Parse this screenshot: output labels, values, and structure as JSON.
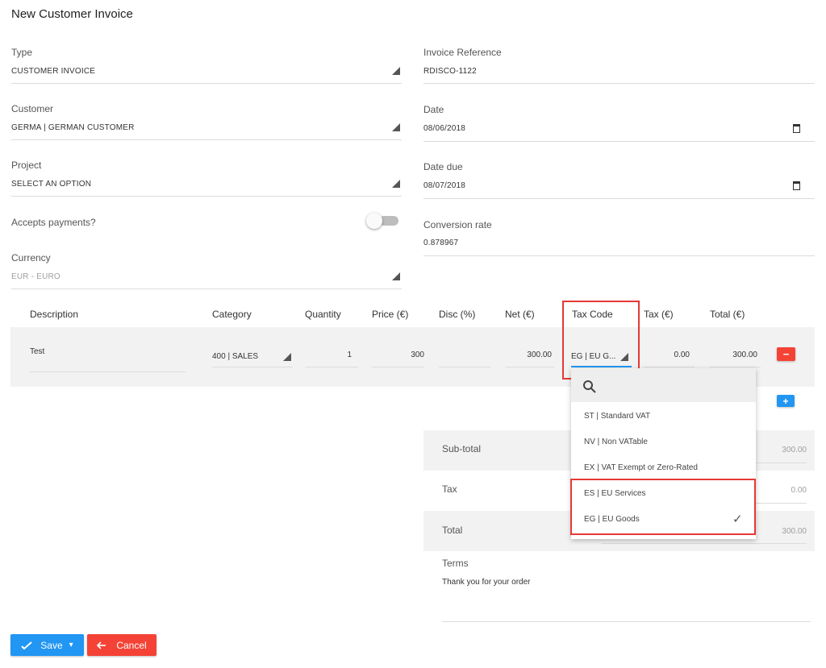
{
  "page": {
    "title": "New Customer Invoice"
  },
  "form": {
    "type": {
      "label": "Type",
      "value": "CUSTOMER INVOICE"
    },
    "invoice_reference": {
      "label": "Invoice Reference",
      "value": "RDISCO-1122"
    },
    "customer": {
      "label": "Customer",
      "value": "GERMA | GERMAN CUSTOMER"
    },
    "date": {
      "label": "Date",
      "value": "08/06/2018"
    },
    "project": {
      "label": "Project",
      "value": "SELECT AN OPTION"
    },
    "date_due": {
      "label": "Date due",
      "value": "08/07/2018"
    },
    "accepts_payments": {
      "label": "Accepts payments?",
      "checked": false
    },
    "conversion_rate": {
      "label": "Conversion rate",
      "value": "0.878967"
    },
    "currency": {
      "label": "Currency",
      "value": "EUR - EURO"
    }
  },
  "lines": {
    "headers": {
      "description": "Description",
      "category": "Category",
      "quantity": "Quantity",
      "price": "Price (€)",
      "disc": "Disc (%)",
      "net": "Net (€)",
      "tax_code": "Tax Code",
      "tax": "Tax (€)",
      "total": "Total (€)"
    },
    "rows": [
      {
        "description": "Test",
        "category": "400 | SALES",
        "quantity": "1",
        "price": "300",
        "disc": "",
        "net": "300.00",
        "tax_code": "EG | EU G...",
        "tax": "0.00",
        "total": "300.00"
      }
    ],
    "remove_label": "−",
    "add_label": "+"
  },
  "tax_dropdown": {
    "search_icon": "search-icon",
    "options": [
      {
        "label": "ST | Standard VAT",
        "selected": false
      },
      {
        "label": "NV | Non VATable",
        "selected": false
      },
      {
        "label": "EX | VAT Exempt or Zero-Rated",
        "selected": false
      },
      {
        "label": "ES | EU Services",
        "selected": false
      },
      {
        "label": "EG | EU Goods",
        "selected": true
      }
    ],
    "check_glyph": "✓"
  },
  "summary": {
    "subtotal": {
      "label": "Sub-total",
      "value": "300.00"
    },
    "tax": {
      "label": "Tax",
      "value": "0.00"
    },
    "total": {
      "label": "Total",
      "value": "300.00"
    },
    "terms": {
      "label": "Terms",
      "value": "Thank you for your order"
    }
  },
  "actions": {
    "save": {
      "label": "Save",
      "icon": "check-icon",
      "caret": "▾"
    },
    "cancel": {
      "label": "Cancel",
      "icon": "arrow-left-icon"
    }
  },
  "colors": {
    "primary": "#2196f3",
    "danger": "#f44336",
    "highlight": "#e53935"
  }
}
